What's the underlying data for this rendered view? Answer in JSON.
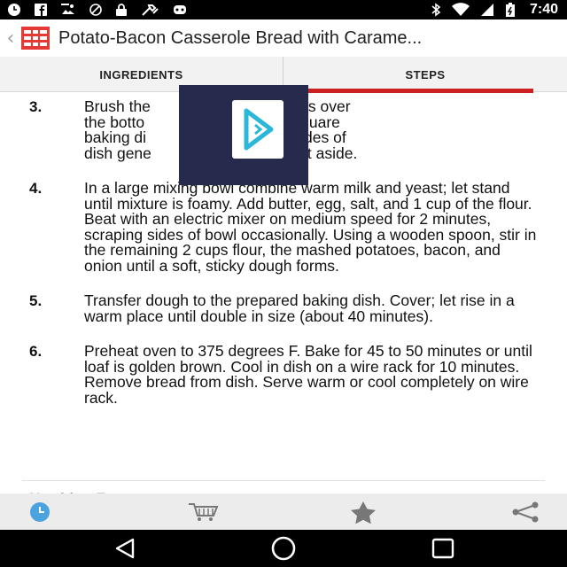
{
  "status_bar": {
    "time": "7:40",
    "icons_left": [
      "clock-icon",
      "facebook-icon",
      "photos-icon",
      "block-icon",
      "lock-icon",
      "wrench-icon",
      "game-controller-icon"
    ],
    "icons_right": [
      "bluetooth-icon",
      "wifi-icon",
      "signal-icon",
      "battery-icon"
    ]
  },
  "app_bar": {
    "title": "Potato-Bacon Casserole Bread with Carame..."
  },
  "tabs": [
    {
      "label": "INGREDIENTS",
      "active": false
    },
    {
      "label": "STEPS",
      "active": true
    }
  ],
  "steps": [
    {
      "number": "3.",
      "text": "Brush the bottom and sides of a 2-quart square baking dish with bacon drippings over bottom and sides of dish generously with cornmeal. Set aside."
    },
    {
      "number": "4.",
      "text": "In a large mixing bowl combine warm milk and yeast; let stand until mixture is foamy. Add butter, egg, salt, and 1 cup of the flour. Beat with an electric mixer on medium speed for 2 minutes, scraping sides of bowl occasionally. Using a wooden spoon, stir in the remaining 2 cups flour, the mashed potatoes, bacon, and onion until a soft, sticky dough forms."
    },
    {
      "number": "5.",
      "text": "Transfer dough to the prepared baking dish. Cover; let rise in a warm place until double in size (about 40 minutes)."
    },
    {
      "number": "6.",
      "text": "Preheat oven to 375 degrees F. Bake for 45 to 50 minutes or until loaf is golden brown. Cool in dish on a wire rack for 10 minutes. Remove bread from dish. Serve warm or cool completely on wire rack."
    }
  ],
  "step3_lines": [
    "Brush the                 con drippings over",
    "the botto               of a 2-quart square",
    "baking di               bottom and sides of",
    "dish gene               cornmeal. Set aside."
  ],
  "next_section_heading": "Nutrition Facts",
  "toolbar": {
    "items": [
      "timer-icon",
      "cart-icon",
      "star-icon",
      "share-icon"
    ],
    "accent": "#4aa3df"
  },
  "nav_bar": {
    "items": [
      "back-icon",
      "home-icon",
      "recents-icon"
    ]
  },
  "colors": {
    "accent_red": "#cc1f1f",
    "overlay_bg": "#262a4d",
    "overlay_icon": "#2bb7d8"
  }
}
